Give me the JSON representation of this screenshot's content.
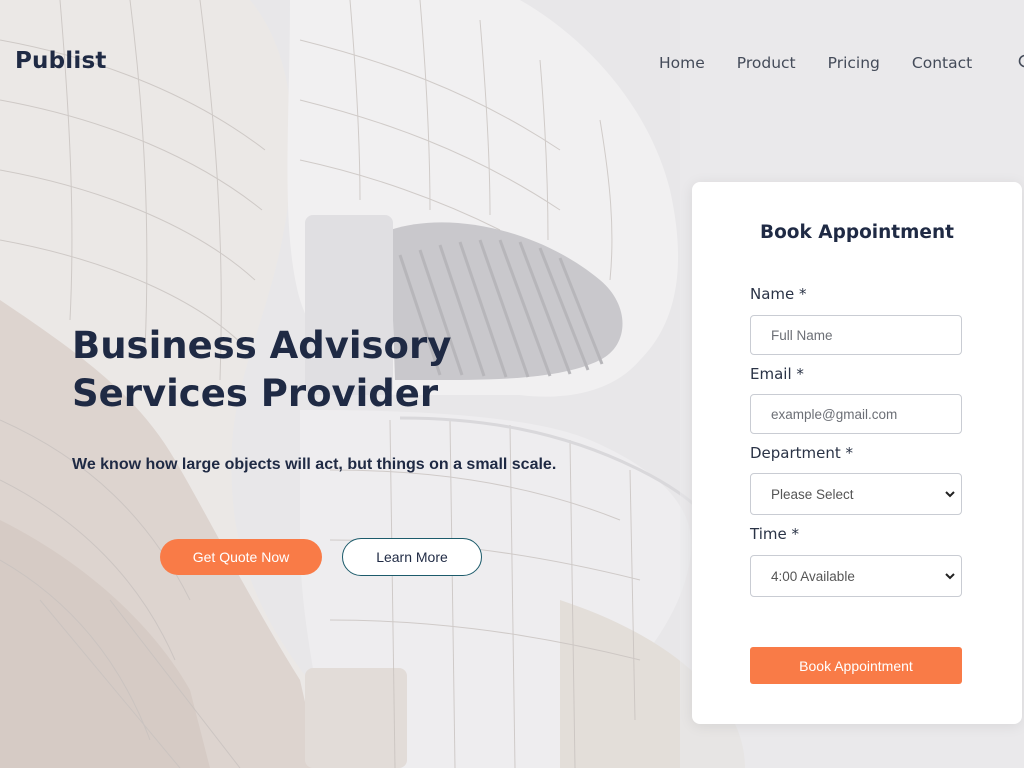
{
  "header": {
    "brand": "Publist",
    "nav": [
      {
        "label": "Home"
      },
      {
        "label": "Product"
      },
      {
        "label": "Pricing"
      },
      {
        "label": "Contact"
      }
    ],
    "search_icon": "search-icon"
  },
  "hero": {
    "title": "Business Advisory Services Provider",
    "subtitle": "We know how large objects will act, but things on a small scale.",
    "primary_button": "Get Quote Now",
    "secondary_button": "Learn More",
    "primary_color": "#f97b47"
  },
  "appointment": {
    "title": "Book Appointment",
    "name_label": "Name *",
    "name_placeholder": "Full Name",
    "email_label": "Email *",
    "email_placeholder": "example@gmail.com",
    "department_label": "Department *",
    "department_selected": "Please Select",
    "time_label": "Time *",
    "time_selected": "4:00 Available",
    "submit": "Book Appointment"
  }
}
